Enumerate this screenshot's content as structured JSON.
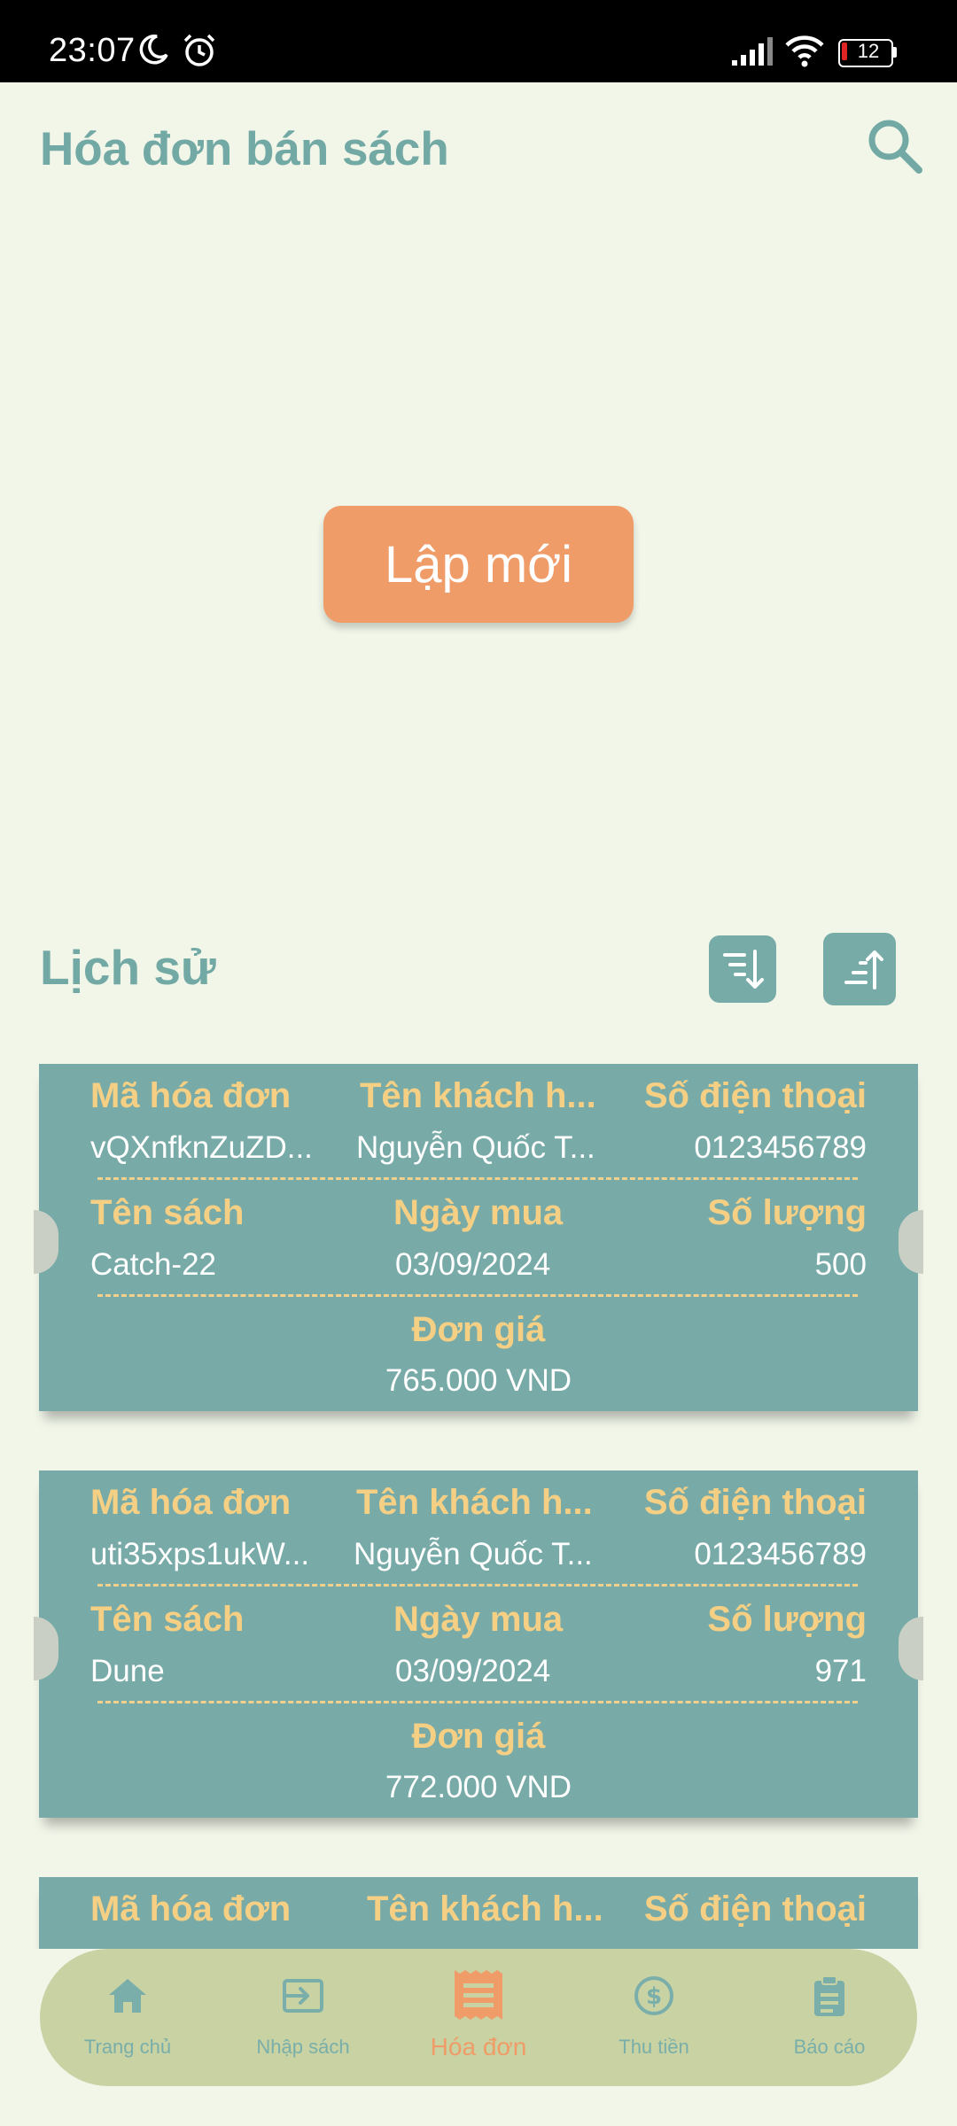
{
  "status_bar": {
    "time": "23:07",
    "battery": "12"
  },
  "header": {
    "title": "Hóa đơn bán sách",
    "search_icon": "search-icon"
  },
  "actions": {
    "create_label": "Lập mới"
  },
  "history": {
    "title": "Lịch sử",
    "sort_desc_icon": "sort-descending-icon",
    "sort_asc_icon": "sort-ascending-icon",
    "labels": {
      "invoice_id": "Mã hóa đơn",
      "customer": "Tên khách h...",
      "phone": "Số điện thoại",
      "book": "Tên sách",
      "date": "Ngày mua",
      "qty": "Số lượng",
      "price": "Đơn giá"
    },
    "invoices": [
      {
        "invoice_id": "vQXnfknZuZD...",
        "customer": "Nguyễn Quốc T...",
        "phone": "0123456789",
        "book": "Catch-22",
        "date": "03/09/2024",
        "qty": "500",
        "price": "765.000 VND"
      },
      {
        "invoice_id": "uti35xps1ukW...",
        "customer": "Nguyễn Quốc T...",
        "phone": "0123456789",
        "book": "Dune",
        "date": "03/09/2024",
        "qty": "971",
        "price": "772.000 VND"
      },
      {
        "invoice_id": "",
        "customer": "",
        "phone": "",
        "book": "",
        "date": "",
        "qty": "",
        "price": ""
      }
    ]
  },
  "nav": {
    "items": [
      {
        "label": "Trang chủ",
        "icon": "home-icon"
      },
      {
        "label": "Nhập sách",
        "icon": "import-icon"
      },
      {
        "label": "Hóa đơn",
        "icon": "receipt-icon",
        "active": true
      },
      {
        "label": "Thu tiền",
        "icon": "dollar-icon"
      },
      {
        "label": "Báo cáo",
        "icon": "clipboard-icon"
      }
    ]
  },
  "colors": {
    "background": "#f1f6e9",
    "accent_teal": "#73a9a5",
    "card": "#78aba8",
    "card_label": "#f5cf84",
    "primary_button": "#ef9c68",
    "nav_background": "#c8d2a3"
  }
}
